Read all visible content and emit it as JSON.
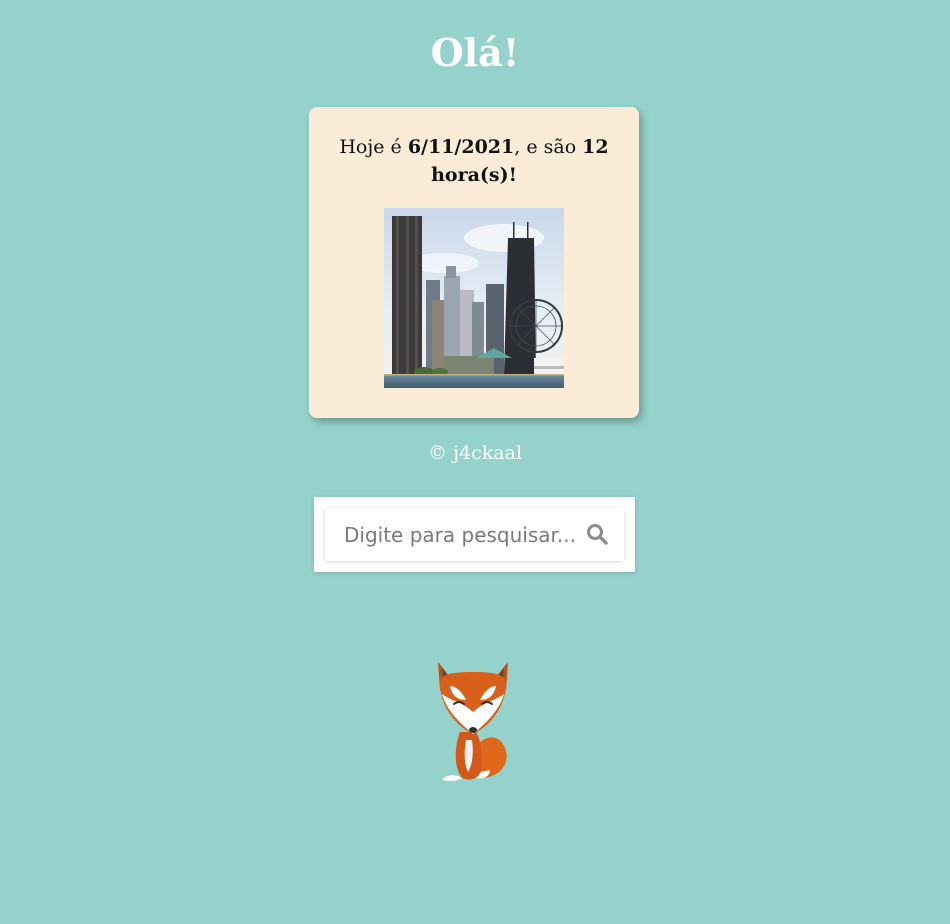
{
  "header": {
    "greeting": "Olá!"
  },
  "card": {
    "prefix": "Hoje é ",
    "date": "6/11/2021",
    "middle": ", e são ",
    "hour": "12",
    "hour_suffix": "hora(s)!",
    "image_icon": "city-skyline-photo"
  },
  "footer": {
    "copyright": "© j4ckaal"
  },
  "search": {
    "placeholder": "Digite para pesquisar...",
    "value": "",
    "button_icon": "search-icon"
  },
  "mascot": {
    "icon": "fox-icon"
  },
  "colors": {
    "background": "#95d2cb",
    "card": "#fbecd7",
    "text_light": "#ffffff",
    "fox_orange": "#e0661c",
    "fox_dark": "#b94812"
  }
}
